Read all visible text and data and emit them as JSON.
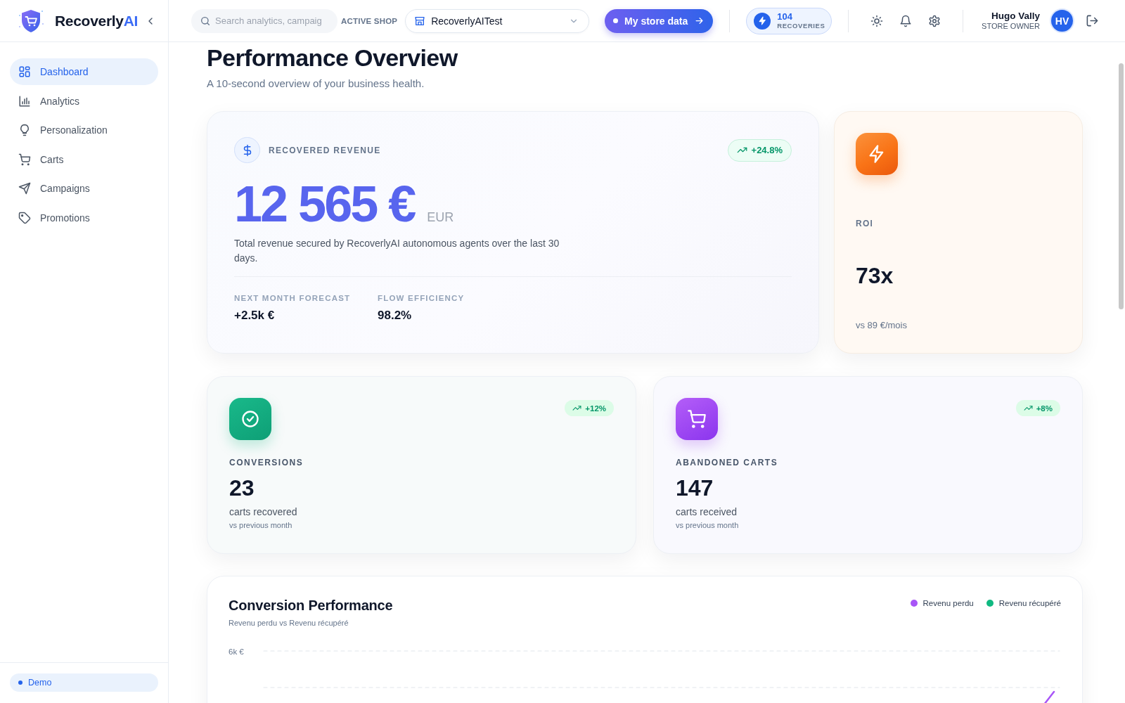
{
  "sidebar": {
    "brand": {
      "name": "Recoverly",
      "accent": "AI"
    },
    "items": [
      {
        "label": "Dashboard",
        "selected": true
      },
      {
        "label": "Analytics",
        "selected": false
      },
      {
        "label": "Personalization",
        "selected": false
      },
      {
        "label": "Carts",
        "selected": false
      },
      {
        "label": "Campaigns",
        "selected": false
      },
      {
        "label": "Promotions",
        "selected": false
      }
    ],
    "mode_badge": "Demo"
  },
  "top_bar": {
    "search": {
      "placeholder": "Search analytics, campaig"
    },
    "active_shop_label": "ACTIVE SHOP",
    "shop_select": {
      "value": "RecoverlyAITest"
    },
    "store_data_button": "My store data",
    "recoveries": {
      "count": "104",
      "label": "RECOVERIES"
    },
    "user": {
      "name": "Hugo Vally",
      "role": "STORE OWNER",
      "initials": "HV"
    }
  },
  "page": {
    "title": "Performance Overview",
    "subtitle": "A 10-second overview of your business health."
  },
  "revenue_card": {
    "label": "RECOVERED REVENUE",
    "trend": "+24.8%",
    "amount": "12 565 €",
    "currency": "EUR",
    "description": "Total revenue secured by RecoverlyAI autonomous agents over the last 30 days.",
    "stats": [
      {
        "label": "NEXT MONTH FORECAST",
        "value": "+2.5k €"
      },
      {
        "label": "FLOW EFFICIENCY",
        "value": "98.2%"
      }
    ]
  },
  "roi_card": {
    "label": "ROI",
    "value": "73x",
    "note": "vs 89 €/mois"
  },
  "metric_cards": [
    {
      "kind": "conversion",
      "label": "CONVERSIONS",
      "trend": "+12%",
      "value": "23",
      "caption": "carts recovered",
      "note": "vs previous month"
    },
    {
      "kind": "cart",
      "label": "ABANDONED CARTS",
      "trend": "+8%",
      "value": "147",
      "caption": "carts received",
      "note": "vs previous month"
    }
  ],
  "chart_panel": {
    "title": "Conversion Performance",
    "subtitle": "Revenu perdu vs Revenu récupéré",
    "legend": [
      {
        "label": "Revenu perdu",
        "color": "#a855f7"
      },
      {
        "label": "Revenu récupéré",
        "color": "#10b981"
      }
    ],
    "y_ticks": [
      "6k €"
    ]
  }
}
